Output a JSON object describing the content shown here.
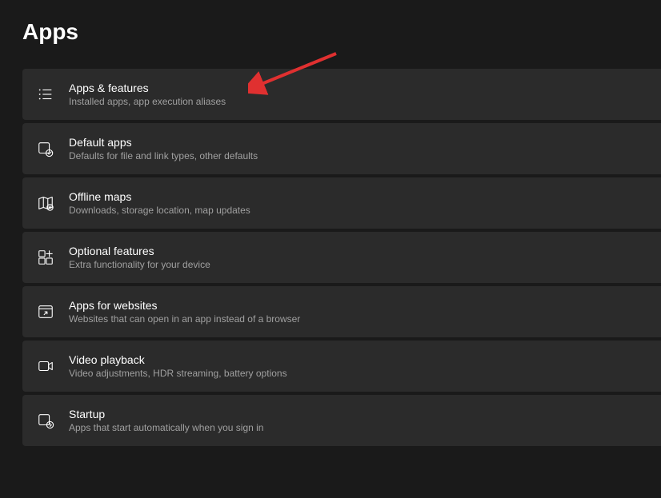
{
  "header": {
    "title": "Apps"
  },
  "items": [
    {
      "id": "apps-features",
      "title": "Apps & features",
      "description": "Installed apps, app execution aliases"
    },
    {
      "id": "default-apps",
      "title": "Default apps",
      "description": "Defaults for file and link types, other defaults"
    },
    {
      "id": "offline-maps",
      "title": "Offline maps",
      "description": "Downloads, storage location, map updates"
    },
    {
      "id": "optional-features",
      "title": "Optional features",
      "description": "Extra functionality for your device"
    },
    {
      "id": "apps-for-websites",
      "title": "Apps for websites",
      "description": "Websites that can open in an app instead of a browser"
    },
    {
      "id": "video-playback",
      "title": "Video playback",
      "description": "Video adjustments, HDR streaming, battery options"
    },
    {
      "id": "startup",
      "title": "Startup",
      "description": "Apps that start automatically when you sign in"
    }
  ],
  "annotation": {
    "arrow_color": "#e03030"
  }
}
